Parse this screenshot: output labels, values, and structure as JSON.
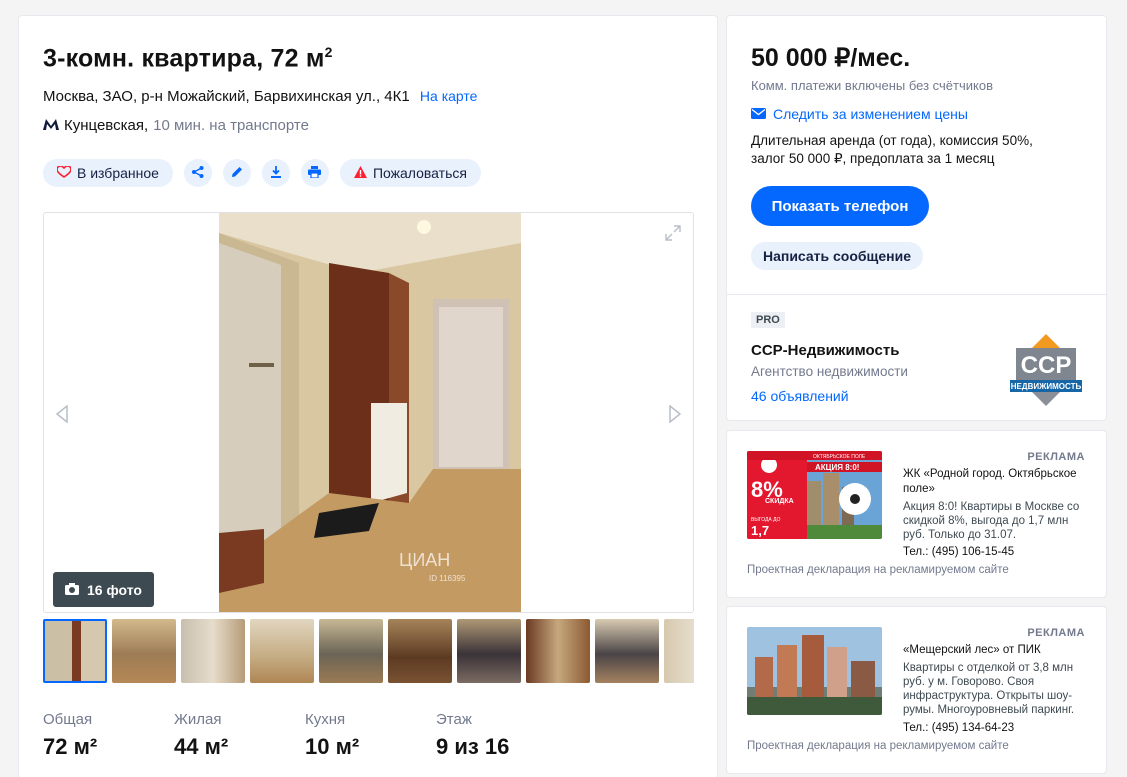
{
  "listing": {
    "title": "3-комн. квартира, 72 м",
    "title_sup": "2",
    "address": "Москва, ЗАО, р-н Можайский, Барвихинская ул., 4К1",
    "map_link": "На карте",
    "metro_station": "Кунцевская,",
    "metro_time": "10 мин. на транспорте"
  },
  "actions": {
    "favorite": "В избранное",
    "complain": "Пожаловаться"
  },
  "gallery": {
    "photo_count": "16 фото",
    "watermark": "ЦИАН",
    "watermark_id": "ID 116395"
  },
  "stats": [
    {
      "label": "Общая",
      "value": "72 м²"
    },
    {
      "label": "Жилая",
      "value": "44 м²"
    },
    {
      "label": "Кухня",
      "value": "10 м²"
    },
    {
      "label": "Этаж",
      "value": "9 из 16"
    }
  ],
  "price_block": {
    "price": "50 000 ₽/мес.",
    "sub": "Комм. платежи включены без счётчиков",
    "track": "Следить за изменением цены",
    "terms_line1": "Длительная аренда (от года), комиссия 50%,",
    "terms_line2": "залог 50 000 ₽, предоплата за 1 месяц",
    "phone_button": "Показать телефон",
    "message_button": "Написать сообщение"
  },
  "agent": {
    "badge": "PRO",
    "name": "CCP-Недвижимость",
    "type": "Агентство недвижимости",
    "count": "46 объявлений",
    "logo_text": "CCP",
    "logo_sub": "НЕДВИЖИМОСТЬ"
  },
  "ads": [
    {
      "label": "РЕКЛАМА",
      "title": "ЖК «Родной город. Октябрьское поле»",
      "text": "Акция 8:0! Квартиры в Москве со скидкой 8%, выгода до 1,7 млн руб. Только до 31.07.",
      "phone": "Тел.: (495) 106-15-45",
      "declaration": "Проектная декларация на рекламируемом сайте",
      "banner_top": "ОКТЯБРЬСКОЕ ПОЛЕ",
      "banner_promo": "АКЦИЯ 8:0!",
      "banner_pct": "8%",
      "banner_discount": "СКИДКА",
      "banner_save": "ВЫГОДА ДО",
      "banner_amount": "1,7"
    },
    {
      "label": "РЕКЛАМА",
      "title": "«Мещерский лес» от ПИК",
      "text": "Квартиры с отделкой от 3,8 млн руб. у м. Говорово. Своя инфраструктура. Открыты шоу-румы. Многоуровневый паркинг.",
      "phone": "Тел.: (495) 134-64-23",
      "declaration": "Проектная декларация на рекламируемом сайте"
    }
  ],
  "colors": {
    "accent": "#0468ff",
    "pill_bg": "#e9f1fd",
    "warning": "#ff1f34"
  }
}
